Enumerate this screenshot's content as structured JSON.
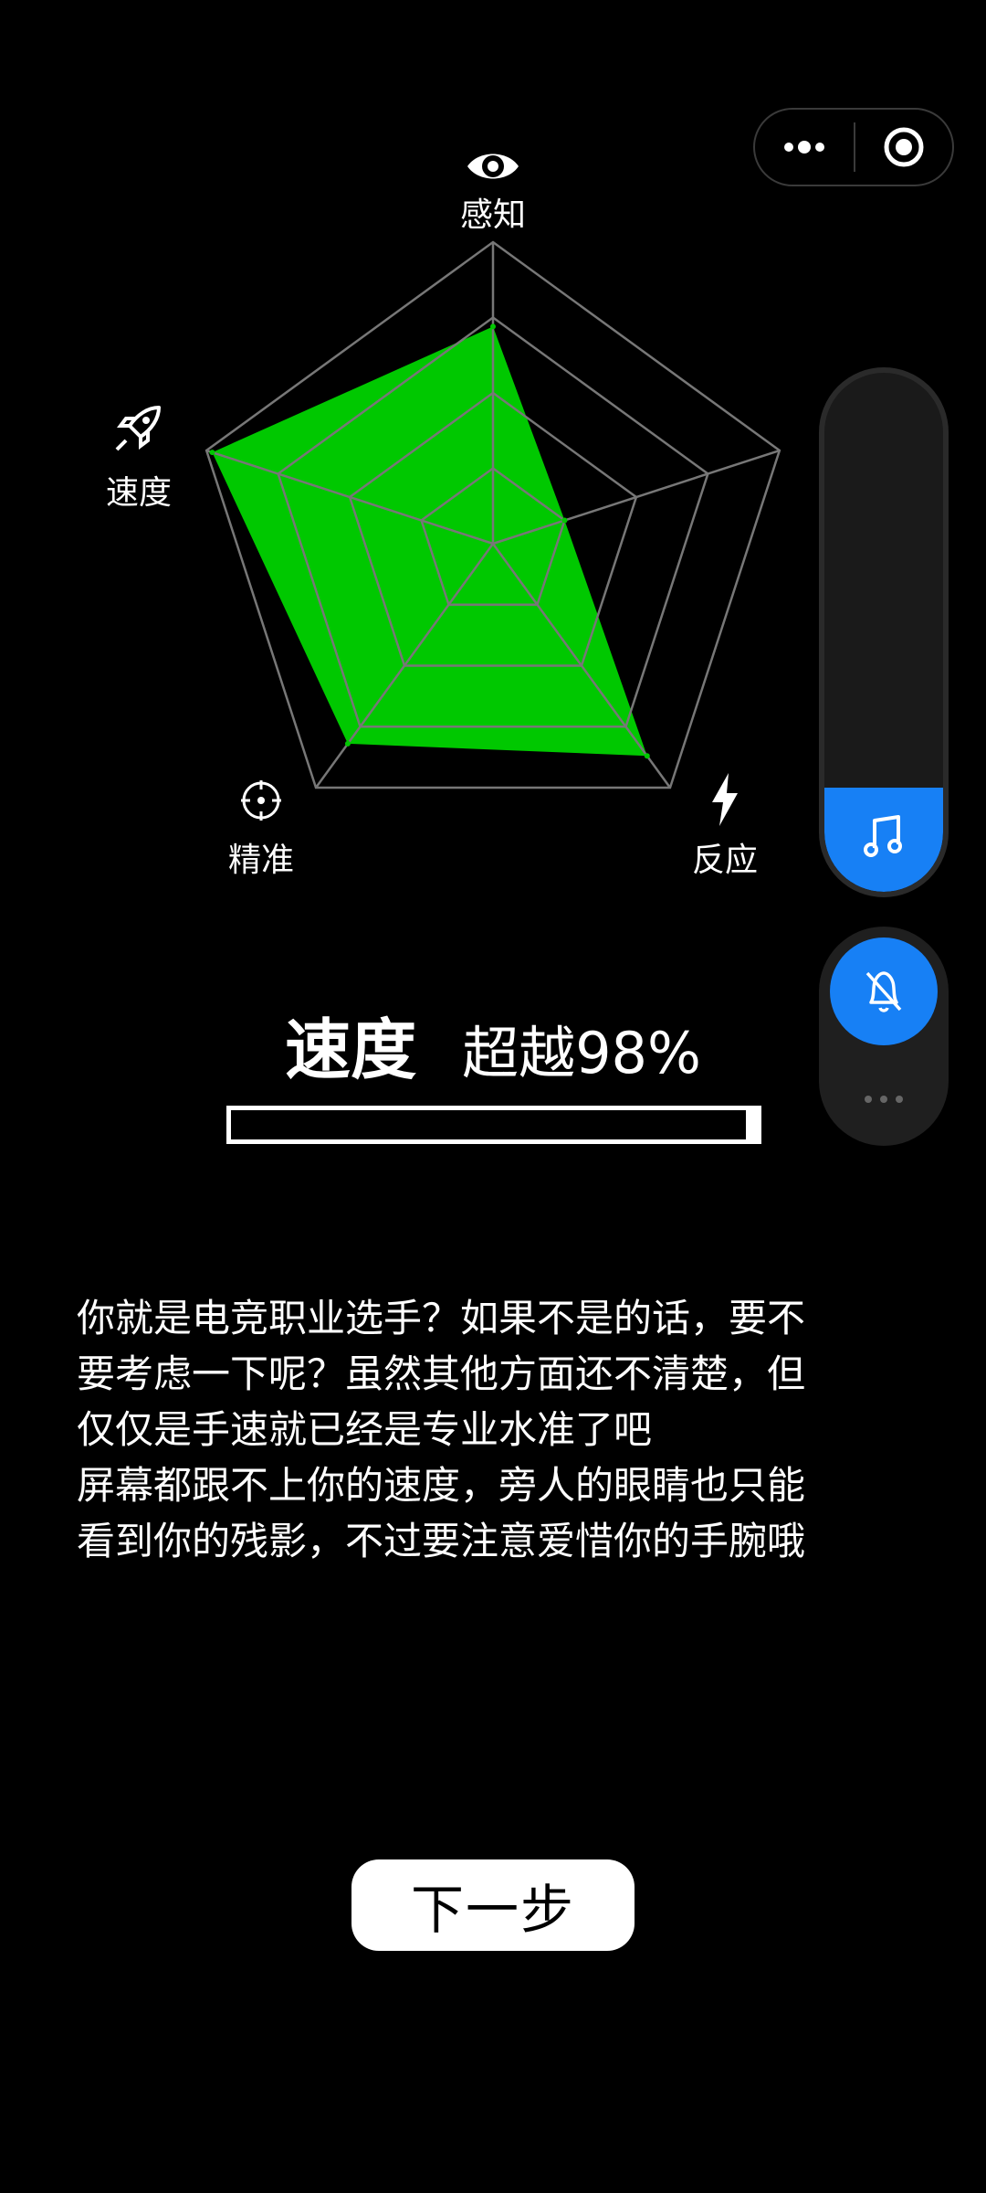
{
  "capsule": {
    "more_icon": "more-dots-icon",
    "close_icon": "target-circle-icon"
  },
  "radar": {
    "axes": [
      {
        "label": "感知",
        "icon": "eye-icon",
        "value": 0.72
      },
      {
        "label": "",
        "icon": "",
        "value": 0.25
      },
      {
        "label": "反应",
        "icon": "lightning-icon",
        "value": 0.87
      },
      {
        "label": "精准",
        "icon": "crosshair-icon",
        "value": 0.82
      },
      {
        "label": "速度",
        "icon": "rocket-icon",
        "value": 0.98
      }
    ],
    "fill_color": "#00c800",
    "grid_color": "#777777",
    "levels": 4
  },
  "volume": {
    "icon": "music-note-icon",
    "level": 0.2,
    "accent": "#1780f5"
  },
  "mute": {
    "icon": "bell-off-icon",
    "more_icon": "more-dots-icon"
  },
  "result": {
    "stat_name": "速度",
    "beat_text": "超越98%",
    "progress": 0.98
  },
  "description": "你就是电竞职业选手？如果不是的话，要不\n要考虑一下呢？虽然其他方面还不清楚，但\n仅仅是手速就已经是专业水准了吧\n屏幕都跟不上你的速度，旁人的眼睛也只能\n看到你的残影，不过要注意爱惜你的手腕哦",
  "next_button": "下一步"
}
